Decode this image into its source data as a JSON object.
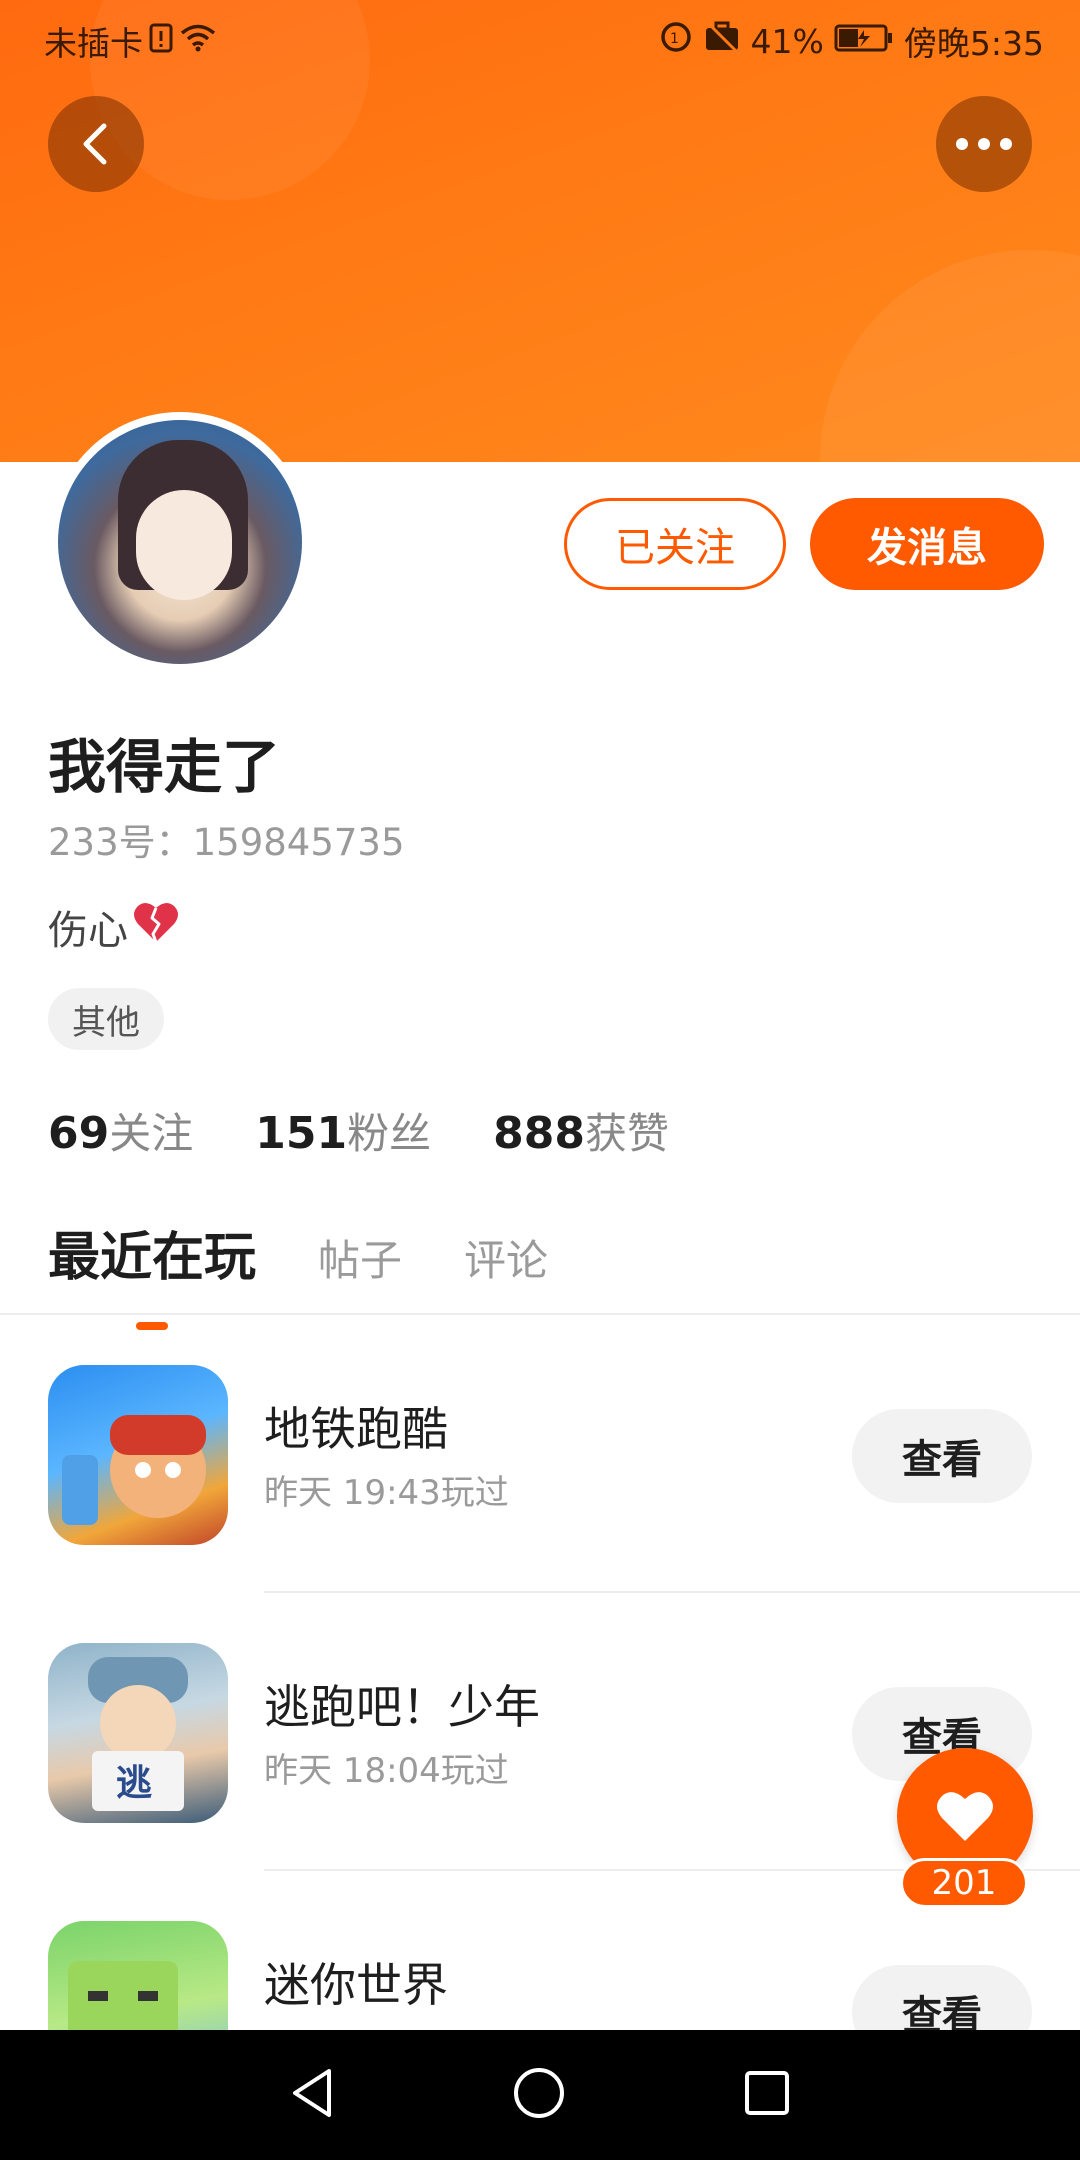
{
  "status_bar": {
    "carrier": "未插卡",
    "battery": "41%",
    "time": "傍晚5:35"
  },
  "profile": {
    "username": "我得走了",
    "uid": "233号：159845735",
    "bio": "伤心",
    "tag": "其他",
    "follow_label": "已关注",
    "message_label": "发消息"
  },
  "stats": {
    "following_count": "69",
    "following_label": "关注",
    "followers_count": "151",
    "followers_label": "粉丝",
    "likes_count": "888",
    "likes_label": "获赞"
  },
  "tabs": [
    {
      "label": "最近在玩",
      "active": true
    },
    {
      "label": "帖子",
      "active": false
    },
    {
      "label": "评论",
      "active": false
    }
  ],
  "games": [
    {
      "name": "地铁跑酷",
      "played": "昨天 19:43玩过",
      "button": "查看"
    },
    {
      "name": "逃跑吧！少年",
      "played": "昨天 18:04玩过",
      "button": "查看"
    },
    {
      "name": "迷你世界",
      "played": "",
      "button": "查看"
    }
  ],
  "like_fab": {
    "count": "201"
  },
  "colors": {
    "accent": "#ff5a00",
    "banner": "#ff7a14"
  }
}
